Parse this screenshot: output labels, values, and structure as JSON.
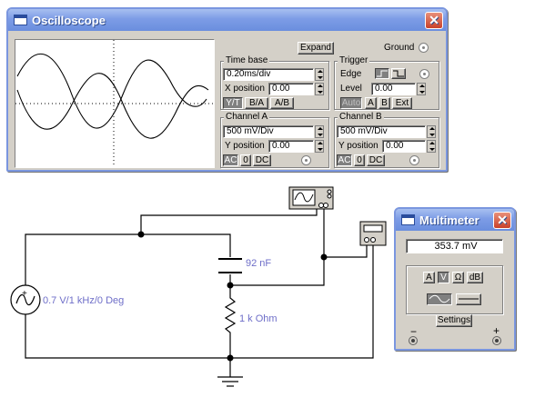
{
  "oscilloscope": {
    "title": "Oscilloscope",
    "expand_label": "Expand",
    "ground_label": "Ground",
    "timebase": {
      "group_label": "Time base",
      "value": "0.20ms/div",
      "xpos_label": "X position",
      "xpos_value": "0.00",
      "modes": [
        "Y/T",
        "B/A",
        "A/B"
      ],
      "active_mode": "Y/T"
    },
    "trigger": {
      "group_label": "Trigger",
      "edge_label": "Edge",
      "level_label": "Level",
      "level_value": "0.00",
      "sources": [
        "Auto",
        "A",
        "B",
        "Ext"
      ]
    },
    "channel_a": {
      "group_label": "Channel A",
      "value": "500 mV/Div",
      "ypos_label": "Y position",
      "ypos_value": "0.00",
      "coupling": [
        "AC",
        "0",
        "DC"
      ],
      "active": "AC"
    },
    "channel_b": {
      "group_label": "Channel B",
      "value": "500 mV/Div",
      "ypos_label": "Y position",
      "ypos_value": "0.00",
      "coupling": [
        "AC",
        "0",
        "DC"
      ],
      "active": "AC"
    }
  },
  "multimeter": {
    "title": "Multimeter",
    "reading": "353.7  mV",
    "modes": [
      "A",
      "V",
      "Ω",
      "dB"
    ],
    "active_mode": "V",
    "settings_label": "Settings",
    "minus_label": "−",
    "plus_label": "+"
  },
  "circuit": {
    "source_label": "0.7 V/1 kHz/0 Deg",
    "capacitor_label": "92 nF",
    "resistor_label": "1 k Ohm"
  }
}
